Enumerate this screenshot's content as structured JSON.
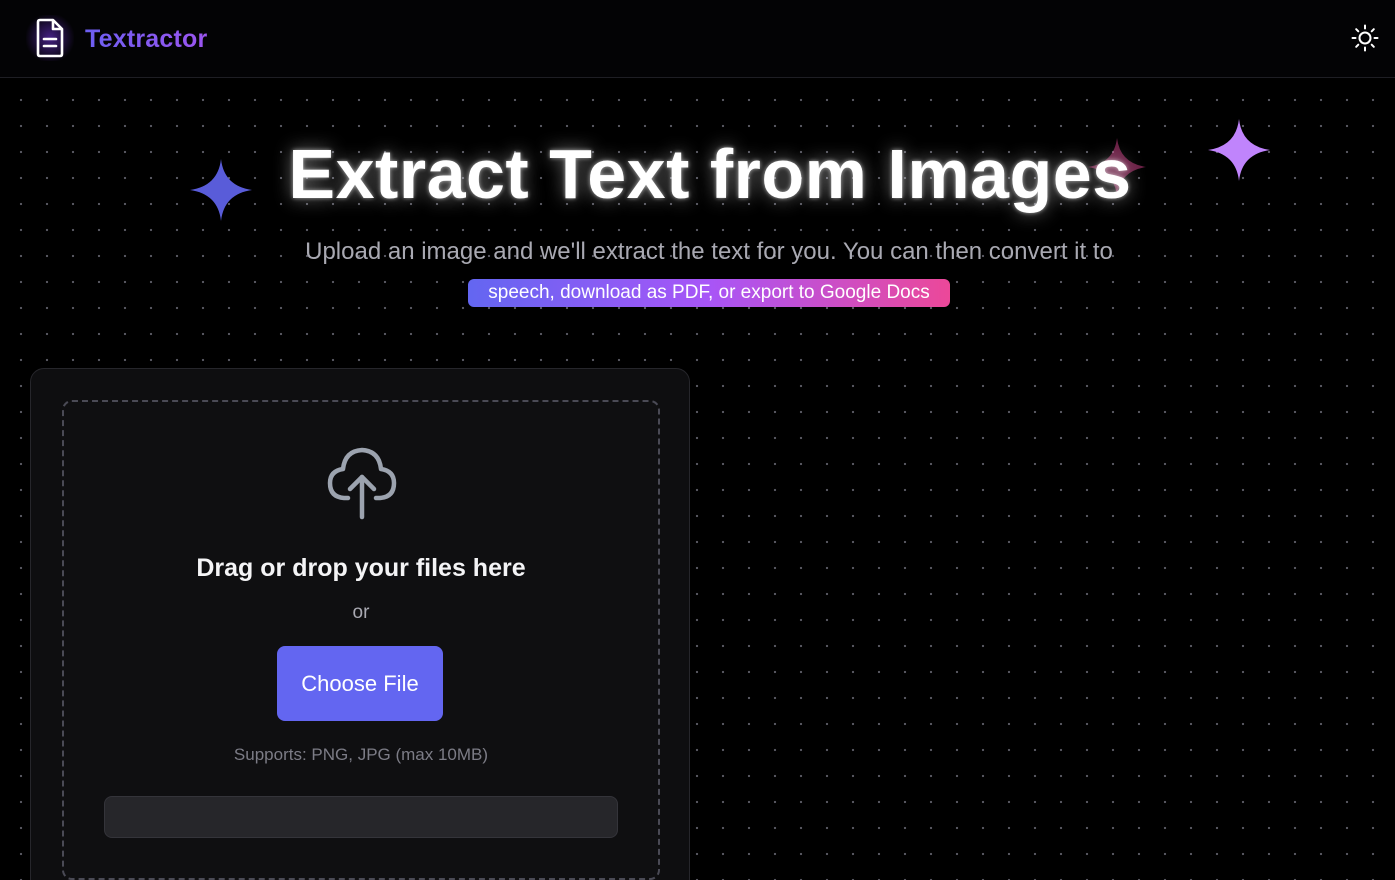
{
  "app": {
    "name": "Textractor"
  },
  "hero": {
    "title": "Extract Text from Images",
    "subtitle": "Upload an image and we'll extract the text for you. You can then convert it to",
    "highlight": "speech, download as PDF, or export to Google Docs"
  },
  "upload": {
    "title": "Drag or drop your files here",
    "or_label": "or",
    "button_label": "Choose File",
    "supports": "Supports: PNG, JPG (max 10MB)"
  },
  "icons": {
    "logo": "document-icon",
    "theme": "sun-icon",
    "upload": "cloud-upload-icon",
    "sparkles": [
      "sparkle-icon",
      "sparkle-icon",
      "sparkle-icon"
    ]
  },
  "colors": {
    "accent": "#6366f1",
    "brand_start": "#6d5ff2",
    "brand_end": "#9b55f0",
    "highlight_start": "#6366f1",
    "highlight_mid": "#a855f7",
    "highlight_end": "#ec4899",
    "background": "#000000"
  }
}
